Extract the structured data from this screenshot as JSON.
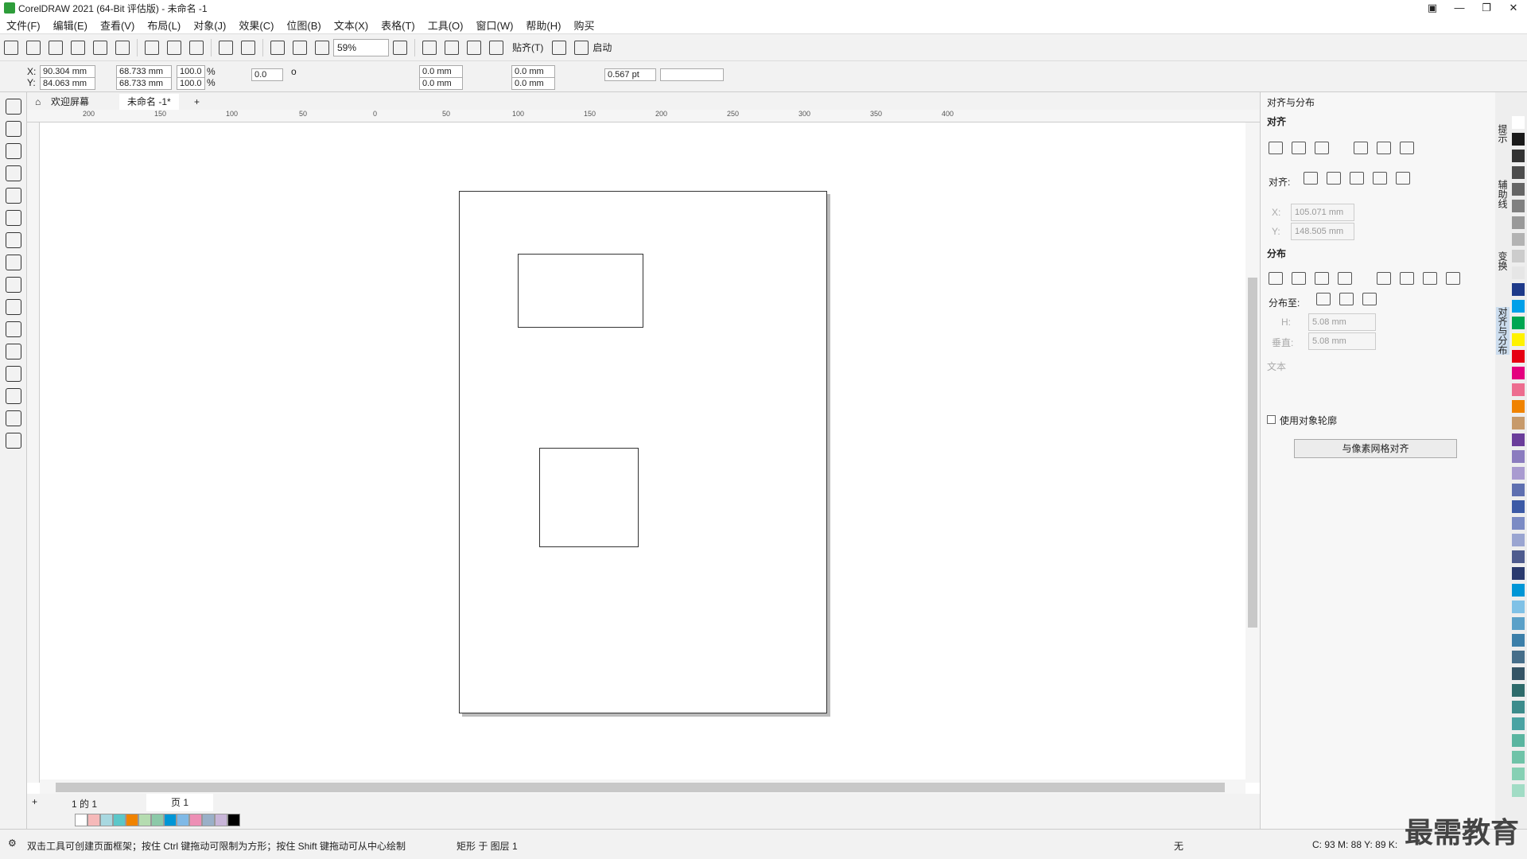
{
  "title": "CorelDRAW 2021 (64-Bit 评估版) - 未命名 -1",
  "menu": [
    "文件(F)",
    "编辑(E)",
    "查看(V)",
    "布局(L)",
    "对象(J)",
    "效果(C)",
    "位图(B)",
    "文本(X)",
    "表格(T)",
    "工具(O)",
    "窗口(W)",
    "帮助(H)",
    "购买"
  ],
  "toolbar": {
    "zoom": "59%",
    "snap": "贴齐(T)",
    "launch": "启动"
  },
  "props": {
    "x": "90.304 mm",
    "y": "84.063 mm",
    "w": "68.733 mm",
    "h": "68.733 mm",
    "sx": "100.0",
    "sy": "100.0",
    "pct": "%",
    "rot": "0.0",
    "deg": "o",
    "c1": "0.0 mm",
    "c2": "0.0 mm",
    "c3": "0.0 mm",
    "c4": "0.0 mm",
    "outline": "0.567 pt",
    "xl": "X:",
    "yl": "Y:"
  },
  "tabs": {
    "welcome": "欢迎屏幕",
    "doc": "未命名 -1*"
  },
  "ruler": [
    "200",
    "150",
    "100",
    "50",
    "0",
    "50",
    "100",
    "150",
    "200",
    "250",
    "300",
    "350",
    "400"
  ],
  "pagenav": {
    "pos": "1 的 1",
    "page": "页 1"
  },
  "status": {
    "hint": "双击工具可创建页面框架；按住 Ctrl 键拖动可限制为方形；按住 Shift 键拖动可从中心绘制",
    "obj": "矩形 于 图层 1",
    "fill": "无",
    "color": "C: 93 M: 88 Y: 89 K:"
  },
  "docker": {
    "title": "对齐与分布",
    "align": "对齐",
    "align_to": "对齐:",
    "x": "105.071 mm",
    "y": "148.505 mm",
    "xl": "X:",
    "yl": "Y:",
    "distribute": "分布",
    "dist_to": "分布至:",
    "h": "5.08 mm",
    "v": "5.08 mm",
    "hl": "H:",
    "vl": "垂直:",
    "text": "文本",
    "use_outline": "使用对象轮廓",
    "pixel_grid": "与像素网格对齐"
  },
  "sidetabs": [
    "提示",
    "辅助线",
    "变换",
    "对齐与分布"
  ],
  "palette": [
    "#ffffff",
    "#1a1a1a",
    "#333",
    "#4d4d4d",
    "#666",
    "#808080",
    "#999",
    "#b3b3b3",
    "#ccc",
    "#e6e6e6",
    "#1e3a8a",
    "#00a0e9",
    "#00a651",
    "#fff200",
    "#e60012",
    "#e4007f",
    "#ed6d8f",
    "#f08300",
    "#c79a6b",
    "#6a3d9a",
    "#8b7cbf",
    "#a99bd0",
    "#5e6fb0",
    "#3c5aa6",
    "#7b8bc4",
    "#9aa5d1",
    "#4e5b8e",
    "#2a3a6e",
    "#0096d6",
    "#7fc1e6",
    "#5aa0c8",
    "#3c7fa9",
    "#466e8a",
    "#355466",
    "#2e6b6b",
    "#3c8c8c",
    "#4aa3a3",
    "#5ab5a0",
    "#6fc3a8",
    "#86d0b4",
    "#a1dcc5"
  ],
  "strip": [
    "#f6b9b9",
    "#a8d8e0",
    "#5cc7c9",
    "#f08300",
    "#b5dcb0",
    "#8cc9a8",
    "#0096d6",
    "#7fb9e6",
    "#ed8fb5",
    "#9ab0c8",
    "#c8b5d8",
    "#000000"
  ],
  "watermark": "最需教育"
}
